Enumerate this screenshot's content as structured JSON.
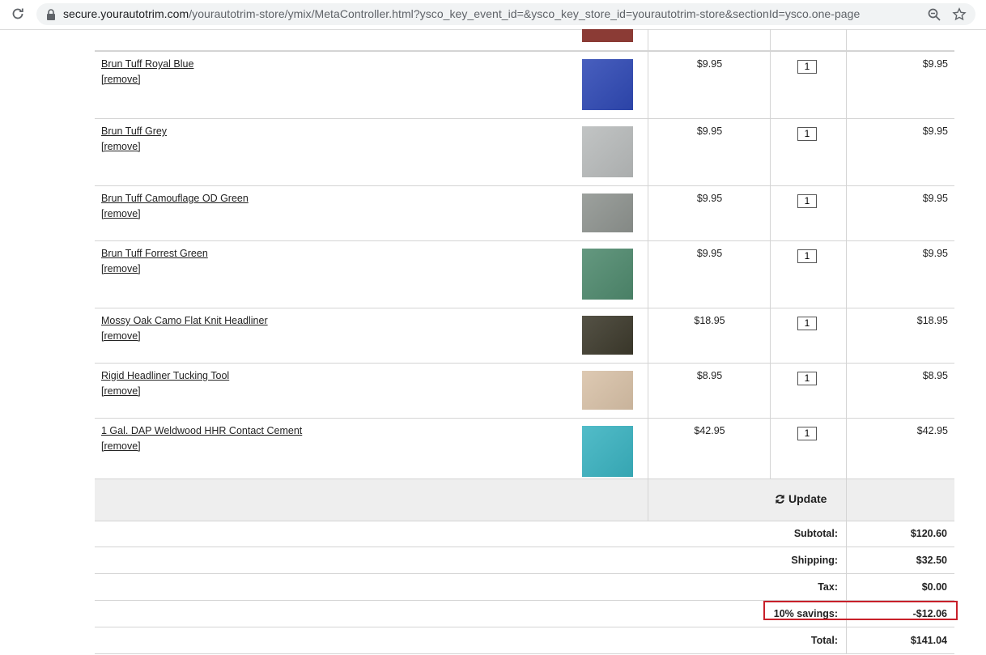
{
  "browser": {
    "url_host": "secure.yourautotrim.com",
    "url_path": "/yourautotrim-store/ymix/MetaController.html?ysco_key_event_id=&ysco_key_store_id=yourautotrim-store&sectionId=ysco.one-page"
  },
  "cart": {
    "items": [
      {
        "name": "Brun Tuff Royal Blue",
        "remove": "[remove]",
        "price": "$9.95",
        "qty": "1",
        "total": "$9.95",
        "swatch": "#2f49b5"
      },
      {
        "name": "Brun Tuff Grey",
        "remove": "[remove]",
        "price": "$9.95",
        "qty": "1",
        "total": "$9.95",
        "swatch": "#b9bcbc"
      },
      {
        "name": "Brun Tuff Camouflage OD Green",
        "remove": "[remove]",
        "price": "$9.95",
        "qty": "1",
        "total": "$9.95",
        "swatch": "#8f9490"
      },
      {
        "name": "Brun Tuff Forrest Green",
        "remove": "[remove]",
        "price": "$9.95",
        "qty": "1",
        "total": "$9.95",
        "swatch": "#4f8a6e"
      },
      {
        "name": "Mossy Oak Camo Flat Knit Headliner",
        "remove": "[remove]",
        "price": "$18.95",
        "qty": "1",
        "total": "$18.95",
        "swatch": "#3d3a2c"
      },
      {
        "name": "Rigid Headliner Tucking Tool",
        "remove": "[remove]",
        "price": "$8.95",
        "qty": "1",
        "total": "$8.95",
        "swatch": "#d9c2a8"
      },
      {
        "name": "1 Gal. DAP Weldwood HHR Contact Cement",
        "remove": "[remove]",
        "price": "$42.95",
        "qty": "1",
        "total": "$42.95",
        "swatch": "#3ab3c1"
      }
    ],
    "update_label": "Update"
  },
  "summary": {
    "subtotal_label": "Subtotal:",
    "subtotal": "$120.60",
    "shipping_label": "Shipping:",
    "shipping": "$32.50",
    "tax_label": "Tax:",
    "tax": "$0.00",
    "savings_label": "10% savings:",
    "savings": "-$12.06",
    "total_label": "Total:",
    "total": "$141.04"
  },
  "colors": {
    "highlight": "#c8202a",
    "update_bg": "#eeeeee"
  }
}
